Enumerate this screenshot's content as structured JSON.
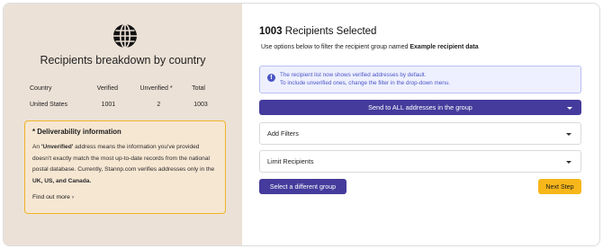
{
  "left": {
    "title": "Recipients breakdown by country",
    "icon": "globe-icon",
    "table": {
      "headers": [
        "Country",
        "Verified",
        "Unverified *",
        "Total"
      ],
      "rows": [
        [
          "United States",
          "1001",
          "2",
          "1003"
        ]
      ]
    },
    "info": {
      "title": "* Deliverability information",
      "body_1": "An ",
      "body_unverified": "'Unverified'",
      "body_2": " address means the information you've provided doesn't exactly match the most up-to-date records from the national postal database. Currently, Stannp.com verifies addresses only in the ",
      "body_countries": "UK, US, and Canada.",
      "find_more": "Find out more ›"
    }
  },
  "right": {
    "count": "1003",
    "title_suffix": " Recipients Selected",
    "subtitle_prefix": "Use options below to filter the recipient group named ",
    "group_name": "Example recipient data",
    "notice_line1": "The recipient list now shows verified addresses by default.",
    "notice_line2": "To include unverified ones, change the filter in the drop-down menu.",
    "send_label": "Send to ALL addresses in the group",
    "add_filters": "Add Filters",
    "limit_recipients": "Limit Recipients",
    "select_group": "Select a different group",
    "next_step": "Next Step"
  },
  "colors": {
    "left_bg": "#ece1d6",
    "primary": "#453b9c",
    "accent": "#f7b61a",
    "notice_text": "#4a55c5"
  }
}
